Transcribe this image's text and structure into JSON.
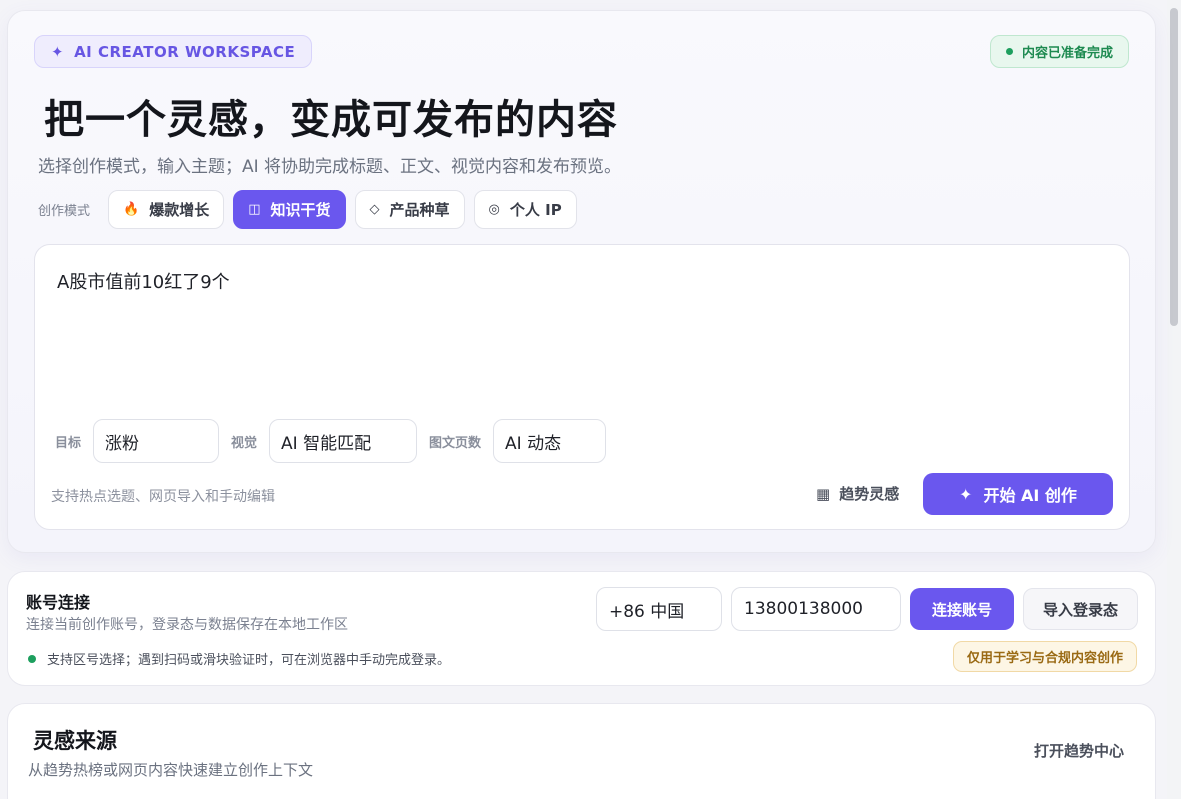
{
  "hero": {
    "tag_label": "AI CREATOR WORKSPACE",
    "status_label": "内容已准备完成",
    "title": "把一个灵感，变成可发布的内容",
    "subtitle": "选择创作模式，输入主题；AI 将协助完成标题、正文、视觉内容和发布预览。",
    "mode_label": "创作模式",
    "modes": [
      {
        "label": "爆款增长",
        "icon": "fire-icon",
        "active": false
      },
      {
        "label": "知识干货",
        "icon": "book-icon",
        "active": true
      },
      {
        "label": "产品种草",
        "icon": "diamond-icon",
        "active": false
      },
      {
        "label": "个人 IP",
        "icon": "target-icon",
        "active": false
      }
    ]
  },
  "editor": {
    "topic_text": "A股市值前10红了9个",
    "options": [
      {
        "label": "目标",
        "value": "涨粉"
      },
      {
        "label": "视觉",
        "value": "AI 智能匹配"
      },
      {
        "label": "图文页数",
        "value": "AI 动态"
      }
    ],
    "hint": "支持热点选题、网页导入和手动编辑",
    "trend_label": "趋势灵感",
    "start_label": "开始 AI 创作"
  },
  "account": {
    "title": "账号连接",
    "subtitle": "连接当前创作账号，登录态与数据保存在本地工作区",
    "region": "+86 中国",
    "phone": "13800138000",
    "connect_label": "连接账号",
    "import_label": "导入登录态",
    "note": "支持区号选择；遇到扫码或滑块验证时，可在浏览器中手动完成登录。",
    "compliance": "仅用于学习与合规内容创作"
  },
  "inspiration": {
    "title": "灵感来源",
    "subtitle": "从趋势热榜或网页内容快速建立创作上下文",
    "open_label": "打开趋势中心"
  },
  "colors": {
    "accent": "#6a57ee",
    "success": "#1d9f5e",
    "warning_text": "#9a6a14"
  }
}
